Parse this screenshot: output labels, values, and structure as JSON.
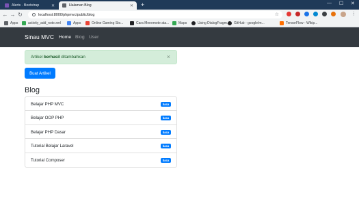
{
  "browser": {
    "tabs": [
      {
        "title": "Alerts · Bootstrap",
        "favicon_color": "#7952b3",
        "active": false
      },
      {
        "title": "Halaman Blog",
        "favicon_color": "#5f6368",
        "active": true
      }
    ],
    "url": "localhost:8000/phpmvc/public/blog",
    "bookmarks": [
      {
        "label": "Apps",
        "color": "#5f6368"
      },
      {
        "label": "activity_add_note.xml",
        "color": "#34a853"
      },
      {
        "label": "Apps",
        "color": "#4285f4"
      },
      {
        "label": "Online Gaming Sto...",
        "color": "#ea4335"
      },
      {
        "label": "Cara Menemote ata...",
        "color": "#202124"
      },
      {
        "label": "Maps",
        "color": "#34a853"
      },
      {
        "label": "Using DialogFragm...",
        "color": "#202124"
      },
      {
        "label": "GitHub - google/m...",
        "color": "#202124"
      },
      {
        "label": "TensorFlow - Wikip...",
        "color": "#ff6f00"
      }
    ]
  },
  "navbar": {
    "brand": "Sinau MVC",
    "links": [
      "Home",
      "Blog",
      "User"
    ]
  },
  "alert": {
    "prefix": "Artikel",
    "bold": "berhasil",
    "suffix": "ditambahkan",
    "close": "×"
  },
  "main": {
    "button_label": "Buat Artikel",
    "heading": "Blog",
    "badge_label": "baca",
    "articles": [
      "Belajar PHP MVC",
      "Belajar OOP PHP",
      "Belajar PHP Dasar",
      "Tutorial Belajar Laravel",
      "Tutorial Composer"
    ]
  }
}
